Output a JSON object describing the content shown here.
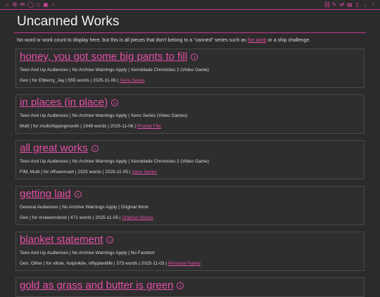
{
  "page": {
    "title": "Uncanned Works",
    "intro_before": "No word or work count to display here, but this is all pieces that don't belong to a \"canned\" series such as ",
    "intro_link": "the lamb",
    "intro_after": " or a ship challenge."
  },
  "toolbar": {
    "left_icons": [
      "home-icon",
      "gear-icon",
      "message-icon",
      "chat-icon",
      "tag-icon",
      "calendar-icon",
      "search-icon"
    ],
    "right_icons": [
      "link-icon",
      "pen-icon",
      "shuffle-icon",
      "archive-icon",
      "document-icon",
      "download-icon",
      "up-icon"
    ]
  },
  "works": [
    {
      "title": "honey, you got some big pants to fill",
      "line1": "Teen And Up Audiences | No Archive Warnings Apply | Xenoblade Chronicles 2 (Video Game)",
      "line2_text": "Gen | for Ebberry_Jay | 555 words | 2025-11-06 | ",
      "series": "Xeno Series"
    },
    {
      "title": "in places (in place)",
      "line1": "Teen And Up Audiences | No Archive Warnings Apply | Xeno Series (Video Games)",
      "line2_text": "Multi | for multishippingmonth | 1948 words | 2025-11-06 | ",
      "series": "Prompt Fills"
    },
    {
      "title": "all great works",
      "line1": "Teen And Up Audiences | No Archive Warnings Apply | Xenoblade Chronicles 2 (Video Game)",
      "line2_text": "F/M, Multi | for offseemoah | 2325 words | 2025-11-05 | ",
      "series": "Xeno Series"
    },
    {
      "title": "getting laid",
      "line1": "General Audiences | No Archive Warnings Apply | Original Work",
      "line2_text": "Gen | for mckeemckool | 471 words | 2025-11-05 | ",
      "series": "Original Stories"
    },
    {
      "title": "blanket statement",
      "line1": "Teen And Up Audiences | No Archive Warnings Apply | No Fandom",
      "line2_text": "Gen, Other | for villsie, hotpinktie, niftyplantlife | 373 words | 2025-11-03 | ",
      "series": "Personal Poetry"
    },
    {
      "title": "gold as grass and butter is green",
      "line1": "",
      "line2_text": "",
      "series": ""
    }
  ],
  "colors": {
    "accent": "#e64fa8",
    "background": "#2b2b2b",
    "card_border": "#4a4a4a"
  }
}
